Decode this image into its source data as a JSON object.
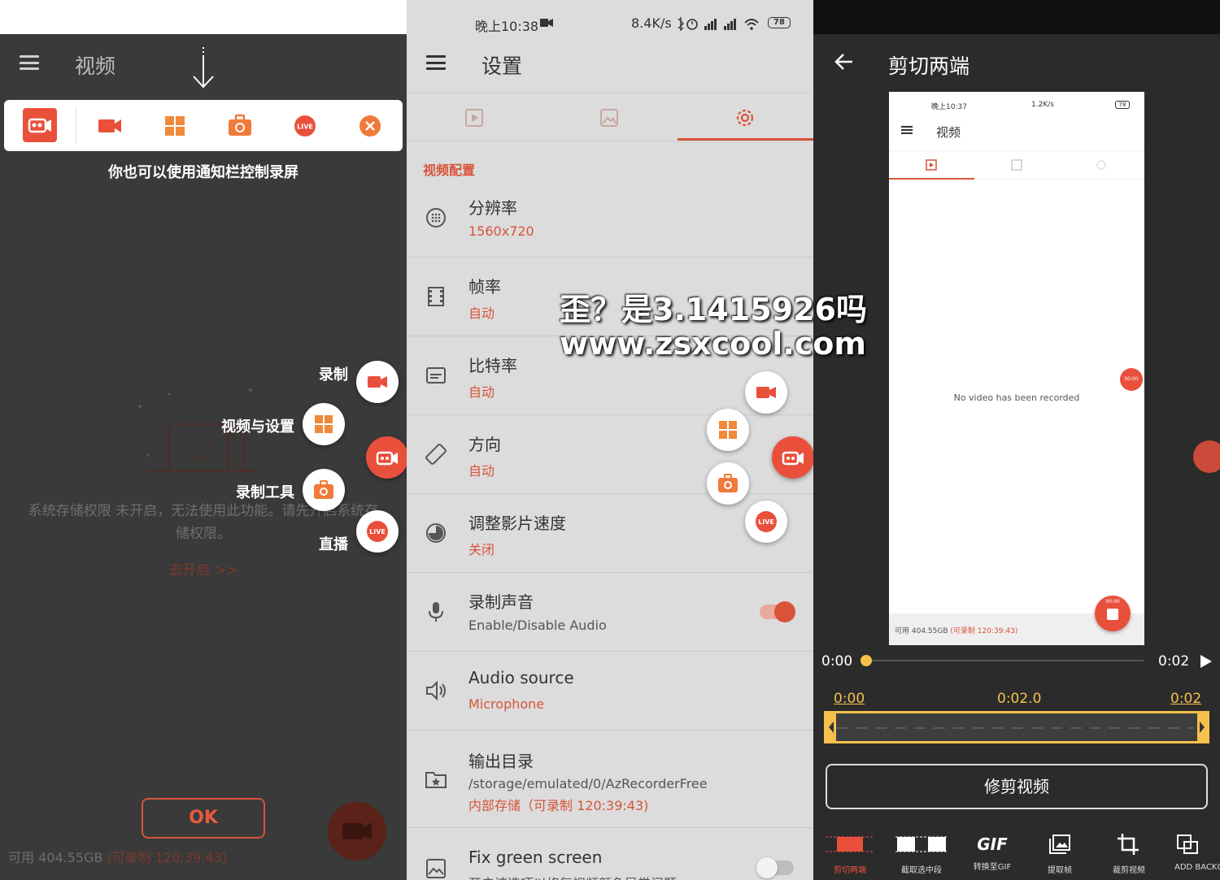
{
  "colors": {
    "accent": "#e9503c",
    "dark_bg": "#3a3a3a",
    "settings_bg": "#dcdcdc",
    "timeline_yellow": "#f5c04c"
  },
  "panel1": {
    "title": "视频",
    "notif_icons": [
      "recorder-app-icon",
      "camera-icon",
      "grid-icon",
      "toolbox-icon",
      "live-icon",
      "close-icon"
    ],
    "hint": "你也可以使用通知栏控制录屏",
    "fab_labels": {
      "record": "录制",
      "videos_settings": "视频与设置",
      "tools": "录制工具",
      "live": "直播"
    },
    "live_badge": "LIVE",
    "permission_line1": "系统存储权限 未开启，无法使用此功能。请先开启系统存",
    "permission_line2": "储权限。",
    "open_link": "去开启 >>",
    "ok": "OK",
    "storage_prefix": "可用 404.55GB ",
    "storage_remaining": "(可录制 120:39:43)"
  },
  "panel2": {
    "status": {
      "time": "晚上10:38",
      "speed": "8.4K/s",
      "battery": "78"
    },
    "title": "设置",
    "section": "视频配置",
    "rows": [
      {
        "title": "分辨率",
        "value": "1560x720"
      },
      {
        "title": "帧率",
        "value": "自动"
      },
      {
        "title": "比特率",
        "value": "自动"
      },
      {
        "title": "方向",
        "value": "自动"
      },
      {
        "title": "调整影片速度",
        "value": "关闭"
      },
      {
        "title": "录制声音",
        "value": "Enable/Disable Audio",
        "toggle": true
      },
      {
        "title": "Audio source",
        "value": "Microphone"
      },
      {
        "title": "输出目录",
        "value": "/storage/emulated/0/AzRecorderFree",
        "value2": "内部存储（可录制 120:39:43)"
      },
      {
        "title": "Fix green screen",
        "value": "开启该选项以修复视频颜色异常问题",
        "toggle": false
      }
    ],
    "live_badge": "LIVE"
  },
  "panel3": {
    "title": "剪切两端",
    "preview": {
      "status_time": "晚上10:37",
      "status_speed": "1.2K/s",
      "battery": "78",
      "title": "视频",
      "empty": "No video has been recorded",
      "timer": "00:00",
      "storage_prefix": "可用 404.55GB ",
      "storage_remaining": "(可录制 120:39:43)"
    },
    "time_start": "0:00",
    "time_end": "0:02",
    "range_start": "0:00",
    "range_mid": "0:02.0",
    "range_end": "0:02",
    "trim_button": "修剪视频",
    "tools": [
      "剪切两端",
      "截取选中段",
      "转换至GIF",
      "提取帧",
      "裁剪视频",
      "ADD BACKG"
    ],
    "gif_glyph": "GIF"
  },
  "watermark": {
    "line1": "歪？是3.1415926吗",
    "line2": "www.zsxcool.com"
  }
}
